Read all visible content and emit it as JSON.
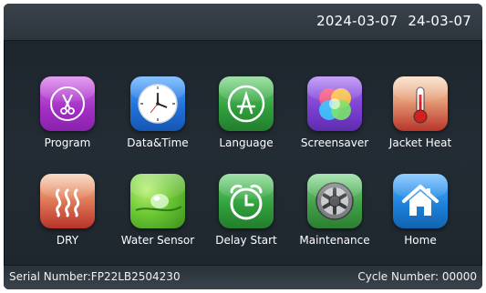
{
  "header": {
    "date": "2024-03-07",
    "time": "24-03-07"
  },
  "tiles": [
    {
      "label": "Program",
      "icon": "scissors-icon",
      "color": "#b13fd1"
    },
    {
      "label": "Data&Time",
      "icon": "clock-icon",
      "color": "#1f6fd6"
    },
    {
      "label": "Language",
      "icon": "app-store-icon",
      "color": "#2f9e3b"
    },
    {
      "label": "Screensaver",
      "icon": "color-bubbles-icon",
      "color": "#7a3fd0"
    },
    {
      "label": "Jacket Heat",
      "icon": "thermometer-icon",
      "color": "#c23a2e"
    },
    {
      "label": "DRY",
      "icon": "heat-waves-icon",
      "color": "#c7402f"
    },
    {
      "label": "Water Sensor",
      "icon": "water-drop-icon",
      "color": "#5bb32a"
    },
    {
      "label": "Delay Start",
      "icon": "alarm-clock-icon",
      "color": "#2f9e3b"
    },
    {
      "label": "Maintenance",
      "icon": "gear-icon",
      "color": "#3e9d44"
    },
    {
      "label": "Home",
      "icon": "home-icon",
      "color": "#1b7fd8"
    }
  ],
  "footer": {
    "serial": "Serial Number:FP22LB2504230",
    "cycle": "Cycle Number: 00000"
  }
}
